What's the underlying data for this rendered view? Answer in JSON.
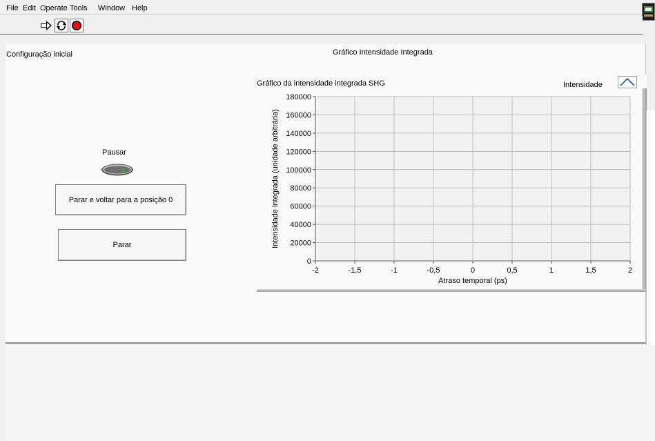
{
  "menubar": {
    "items": [
      "File",
      "Edit",
      "Operate",
      "Tools",
      "Window",
      "Help"
    ]
  },
  "toolbar": {
    "run_icon": "run-arrow-icon",
    "run_continuously_icon": "run-continuously-icon",
    "abort_icon": "abort-execution-icon"
  },
  "panel": {
    "left_title": "Configuração inicial",
    "tab_title": "Gráfico Intensidade Integrada"
  },
  "controls": {
    "pause_label": "Pausar",
    "stop_return_label": "Parar e voltar para a posição 0",
    "stop_label": "Parar"
  },
  "graph": {
    "legend_label": "Intensidade"
  },
  "chart_data": {
    "type": "line",
    "title": "Gráfico da intensidade integrada SHG",
    "xlabel": "Atraso temporal (ps)",
    "ylabel": "Intensidade integrada (unidade arbitrária)",
    "xlim": [
      -2,
      2
    ],
    "ylim": [
      0,
      180000
    ],
    "xticks": [
      "-2",
      "-1,5",
      "-1",
      "-0,5",
      "0",
      "0,5",
      "1",
      "1,5",
      "2"
    ],
    "yticks": [
      "0",
      "20000",
      "40000",
      "60000",
      "80000",
      "100000",
      "120000",
      "140000",
      "160000",
      "180000"
    ],
    "grid": true,
    "legend_position": "top-right",
    "series": [
      {
        "name": "Intensidade",
        "color": "#1f4fd1",
        "x": [],
        "y": []
      }
    ]
  }
}
